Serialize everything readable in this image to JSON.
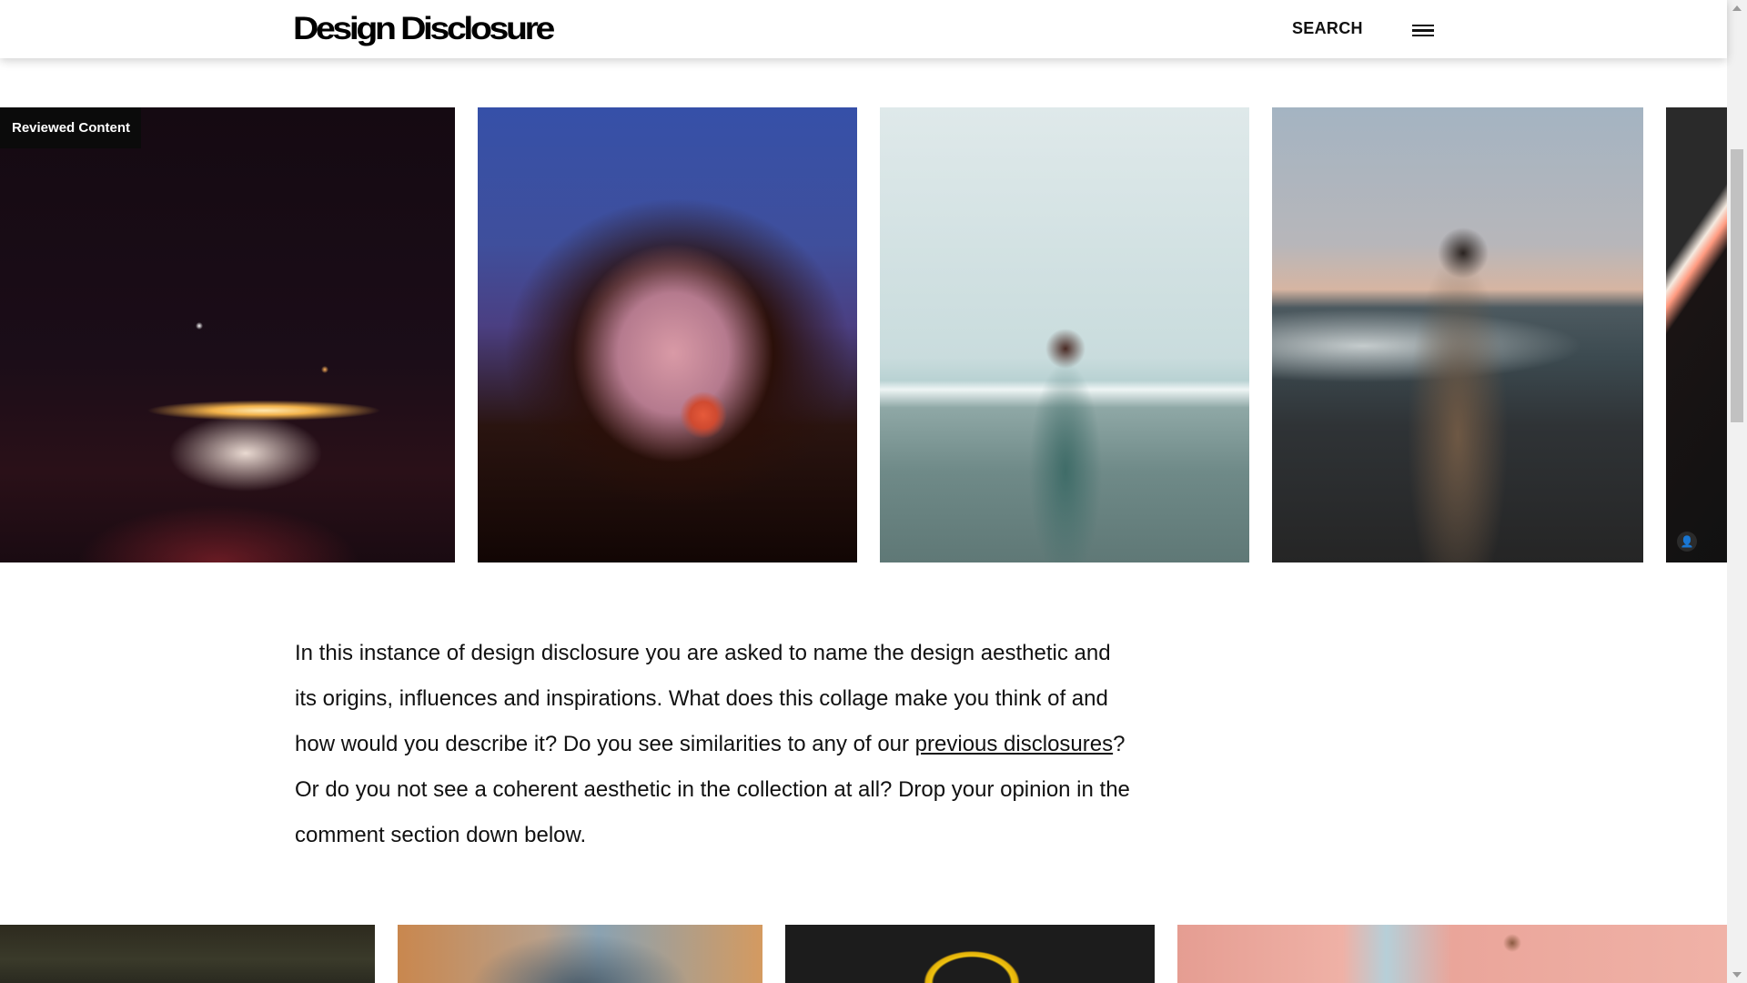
{
  "header": {
    "logo": "Design Disclosure",
    "search_label": "SEARCH",
    "menu_icon": "hamburger-menu-icon"
  },
  "gallery": {
    "badge": "Reviewed Content",
    "images": [
      "gas-station-night-photo",
      "blurred-car-mirror-photo",
      "woman-on-beach-photo",
      "woman-by-sea-photo",
      "neon-light-photo"
    ],
    "user_icon": "user-icon"
  },
  "article": {
    "text_before_link": "In this instance of design disclosure you are asked to name the design aesthetic and its origins, influences and inspirations. What does this collage make you think of and how would you describe it? Do you see similarities to any of our ",
    "link_text": "previous disclosures",
    "text_after_link": "? Or do you not see a coherent aesthetic in the collection at all? Drop your opinion in the comment section down below."
  }
}
